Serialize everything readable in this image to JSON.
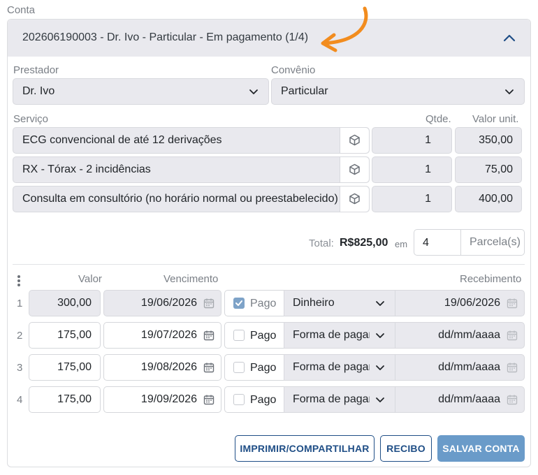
{
  "section_label": "Conta",
  "account_title": "202606190003 - Dr. Ivo - Particular - Em pagamento (1/4)",
  "prestador": {
    "label": "Prestador",
    "value": "Dr. Ivo"
  },
  "convenio": {
    "label": "Convênio",
    "value": "Particular"
  },
  "services_header": {
    "servico": "Serviço",
    "qtde": "Qtde.",
    "valor_unit": "Valor unit."
  },
  "services": [
    {
      "name": "ECG convencional de até 12 derivações",
      "qty": "1",
      "unit_value": "350,00"
    },
    {
      "name": "RX - Tórax - 2 incidências",
      "qty": "1",
      "unit_value": "75,00"
    },
    {
      "name": "Consulta em consultório (no horário normal ou preestabelecido)",
      "qty": "1",
      "unit_value": "400,00"
    }
  ],
  "total": {
    "label": "Total:",
    "value": "R$825,00",
    "em": "em",
    "parcelas": "4",
    "parcelas_suffix": "Parcela(s)"
  },
  "installments_header": {
    "valor": "Valor",
    "vencimento": "Vencimento",
    "recebimento": "Recebimento"
  },
  "installments": [
    {
      "n": "1",
      "valor": "300,00",
      "vencimento": "19/06/2026",
      "pago": true,
      "pago_label": "Pago",
      "forma": "Dinheiro",
      "recebimento": "19/06/2026"
    },
    {
      "n": "2",
      "valor": "175,00",
      "vencimento": "19/07/2026",
      "pago": false,
      "pago_label": "Pago",
      "forma": "Forma de pagamento",
      "recebimento": "dd/mm/aaaa"
    },
    {
      "n": "3",
      "valor": "175,00",
      "vencimento": "19/08/2026",
      "pago": false,
      "pago_label": "Pago",
      "forma": "Forma de pagamento",
      "recebimento": "dd/mm/aaaa"
    },
    {
      "n": "4",
      "valor": "175,00",
      "vencimento": "19/09/2026",
      "pago": false,
      "pago_label": "Pago",
      "forma": "Forma de pagamento",
      "recebimento": "dd/mm/aaaa"
    }
  ],
  "buttons": {
    "print_share": "IMPRIMIR/COMPARTILHAR",
    "receipt": "RECIBO",
    "save": "SALVAR CONTA"
  },
  "icons": {
    "collapse": "chevron-up-icon",
    "dropdown": "chevron-down-icon",
    "service": "cube-icon",
    "date": "calendar-icon",
    "menu": "vertical-dots-icon",
    "annotation": "orange-arrow"
  },
  "colors": {
    "accent": "#1f4e86",
    "primary_button": "#6a9bc9",
    "readonly_bg": "#e9e9ee",
    "annotation_arrow": "#f28c1e",
    "checkbox_checked": "#7ea3c8"
  }
}
